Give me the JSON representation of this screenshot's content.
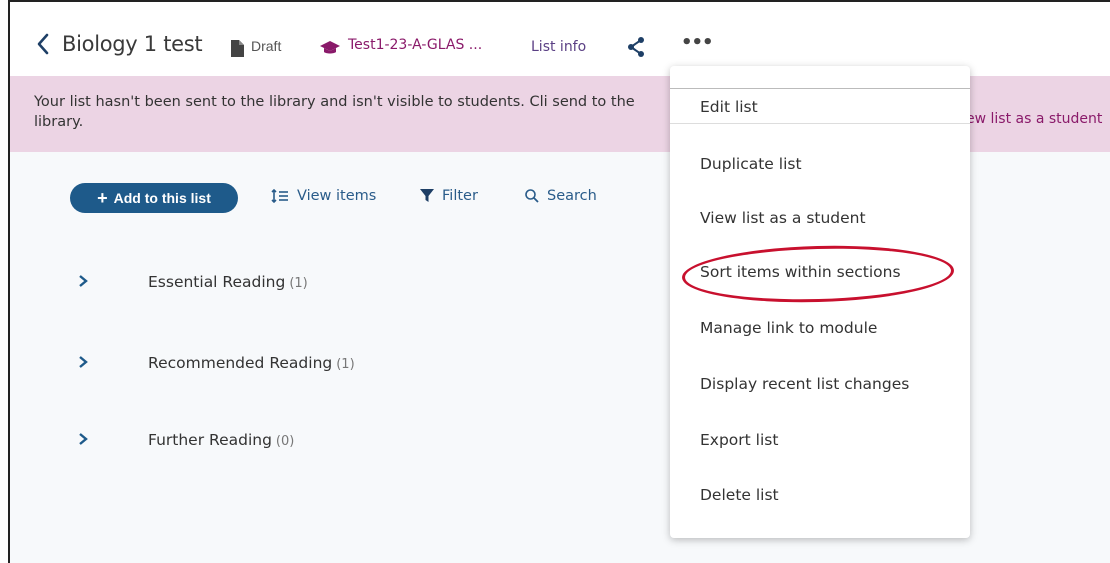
{
  "header": {
    "title": "Biology 1 test",
    "status": "Draft",
    "module": "Test1-23-A-GLAS ...",
    "list_info": "List info",
    "more": "•••"
  },
  "banner": {
    "text": "Your list hasn't been sent to the library and isn't visible to students. Cli send to the library.",
    "link": "ew list as a student"
  },
  "toolbar": {
    "add_label": "Add to this list",
    "view_items_label": "View items",
    "filter_label": "Filter",
    "search_label": "Search"
  },
  "sections": [
    {
      "label": "Essential Reading",
      "count": "(1)"
    },
    {
      "label": "Recommended Reading",
      "count": "(1)"
    },
    {
      "label": "Further Reading",
      "count": "(0)"
    }
  ],
  "menu": {
    "items": [
      "Edit list",
      "Duplicate list",
      "View list as a student",
      "Sort items within sections",
      "Manage link to module",
      "Display recent list changes",
      "Export list",
      "Delete list"
    ],
    "highlighted": "Sort items within sections"
  },
  "colors": {
    "banner_bg": "#ecd4e4",
    "primary_button": "#1e5a8a",
    "link_purple": "#8a1a6a",
    "highlight_oval": "#c8102e"
  }
}
